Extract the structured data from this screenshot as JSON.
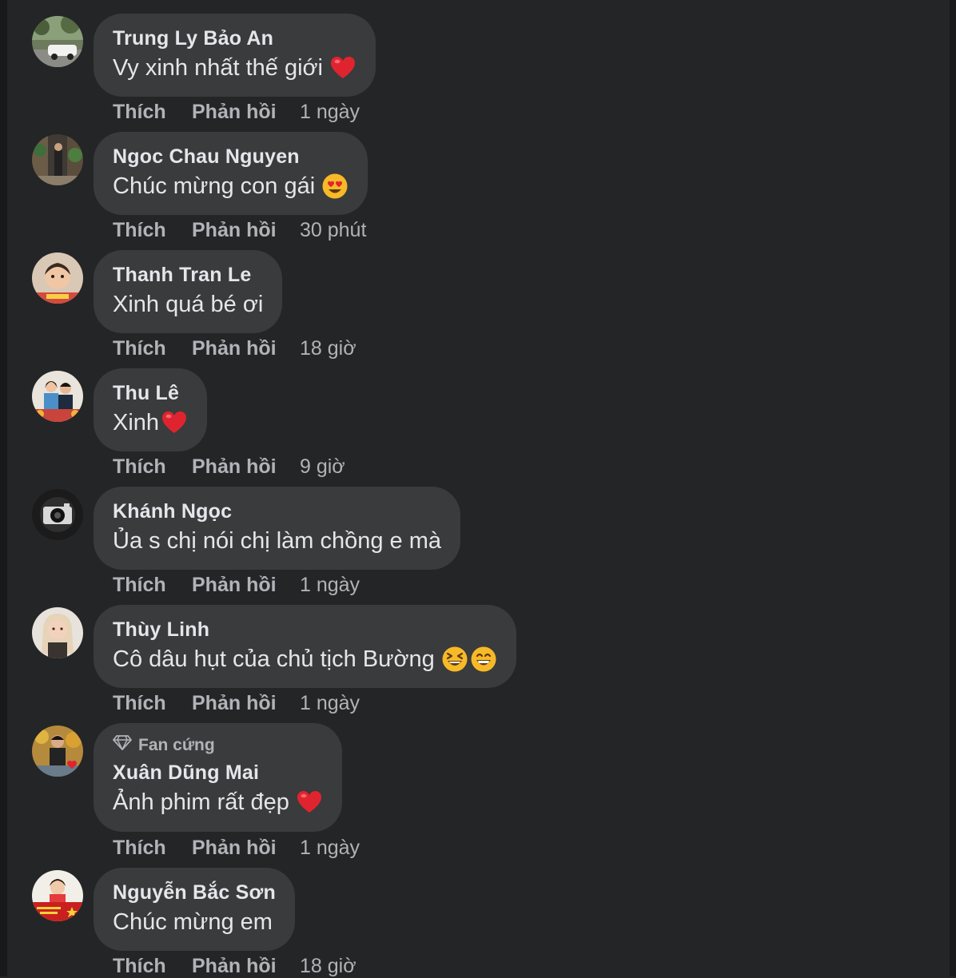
{
  "colors": {
    "background": "#242526",
    "bubble": "#3a3b3c",
    "primary_text": "#e4e6eb",
    "secondary_text": "#b0b3b8"
  },
  "comments": [
    {
      "author": "Trung Ly Bảo An",
      "text": "Vy xinh nhất thế giới",
      "emojis": [
        "red-heart"
      ],
      "like_label": "Thích",
      "reply_label": "Phản hồi",
      "time": "1 ngày"
    },
    {
      "author": "Ngoc Chau Nguyen",
      "text": "Chúc mừng con gái",
      "emojis": [
        "heart-eyes"
      ],
      "like_label": "Thích",
      "reply_label": "Phản hồi",
      "time": "30 phút"
    },
    {
      "author": "Thanh Tran Le",
      "text": "Xinh quá bé ơi",
      "emojis": [],
      "like_label": "Thích",
      "reply_label": "Phản hồi",
      "time": "18 giờ"
    },
    {
      "author": "Thu Lê",
      "text": "Xinh",
      "emojis": [
        "red-heart"
      ],
      "like_label": "Thích",
      "reply_label": "Phản hồi",
      "time": "9 giờ"
    },
    {
      "author": "Khánh Ngọc",
      "text": "Ủa s chị nói chị làm chồng e mà",
      "emojis": [],
      "like_label": "Thích",
      "reply_label": "Phản hồi",
      "time": "1 ngày"
    },
    {
      "author": "Thùy Linh",
      "text": "Cô dâu hụt của chủ tịch Bường",
      "emojis": [
        "laughing-face",
        "grinning-face"
      ],
      "like_label": "Thích",
      "reply_label": "Phản hồi",
      "time": "1 ngày"
    },
    {
      "badge": "Fan cứng",
      "badge_icon": "diamond-icon",
      "author": "Xuân Dũng Mai",
      "text": "Ảnh phim rất đẹp",
      "emojis": [
        "red-heart"
      ],
      "like_label": "Thích",
      "reply_label": "Phản hồi",
      "time": "1 ngày"
    },
    {
      "author": "Nguyễn Bắc Sơn",
      "text": "Chúc mừng em",
      "emojis": [],
      "like_label": "Thích",
      "reply_label": "Phản hồi",
      "time": "18 giờ"
    }
  ]
}
